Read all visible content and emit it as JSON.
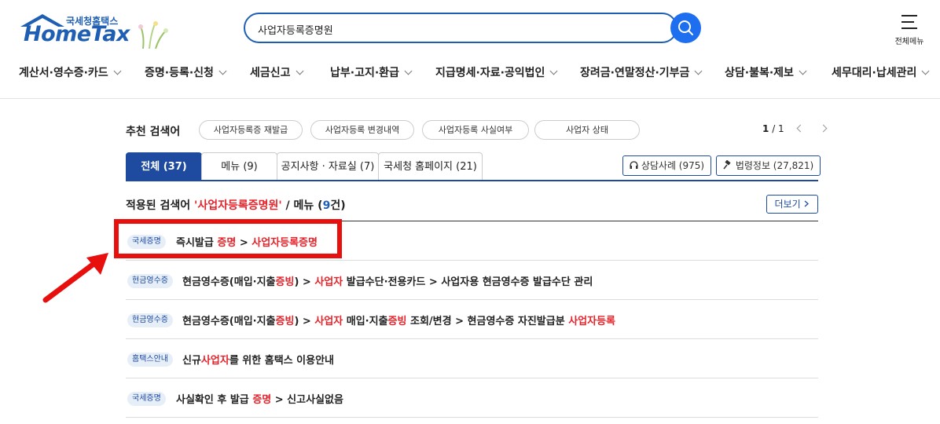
{
  "header": {
    "logo_sub": "국세청홈택스",
    "logo_main": "HomeTax",
    "search_value": "사업자등록증명원",
    "menu_all_label": "전체메뉴"
  },
  "gnb": [
    "계산서·영수증·카드",
    "증명·등록·신청",
    "세금신고",
    "납부·고지·환급",
    "지급명세·자료·공익법인",
    "장려금·연말정산·기부금",
    "상담·불복·제보",
    "세무대리·납세관리"
  ],
  "recommend": {
    "title": "추천 검색어",
    "chips": [
      "사업자등록증 재발급",
      "사업자등록 변경내역",
      "사업자등록 사실여부",
      "사업자 상태"
    ],
    "page_current": "1",
    "page_total": "/ 1"
  },
  "tabs": [
    "전체 (37)",
    "메뉴 (9)",
    "공지사항 · 자료실 (7)",
    "국세청 홈페이지 (21)"
  ],
  "side_buttons": [
    "상담사례 (975)",
    "법령정보 (27,821)"
  ],
  "result_header": {
    "prefix": "적용된 검색어 ",
    "query": "'사업자등록증명원'",
    "mid": " / 메뉴 (",
    "count": "9",
    "suffix": "건)",
    "more": "더보기"
  },
  "rows": [
    {
      "badge": "국세증명",
      "parts": [
        "즉시발급 ",
        "증명",
        " > ",
        "사업자등록증명"
      ]
    },
    {
      "badge": "현금영수증",
      "parts": [
        "현금영수증(매입·지출",
        "증빙",
        ") > ",
        "사업자",
        " 발급수단·전용카드 > 사업자용 현금영수증 발급수단 관리"
      ]
    },
    {
      "badge": "현금영수증",
      "parts": [
        "현금영수증(매입·지출",
        "증빙",
        ") > ",
        "사업자",
        " 매입·지출",
        "증빙",
        " 조회/변경 > 현금영수증 자진발급분 ",
        "사업자등록"
      ]
    },
    {
      "badge": "홈택스안내",
      "parts": [
        "신규",
        "사업자",
        "를 위한 홈택스 이용안내"
      ]
    },
    {
      "badge": "국세증명",
      "parts": [
        "사실확인 후 발급 ",
        "증명",
        " > 신고사실없음"
      ]
    }
  ],
  "colors": {
    "brand": "#1e5fb4",
    "tab_active": "#1e4ba0",
    "highlight": "#e3242b",
    "annotation": "#e80f0f"
  }
}
